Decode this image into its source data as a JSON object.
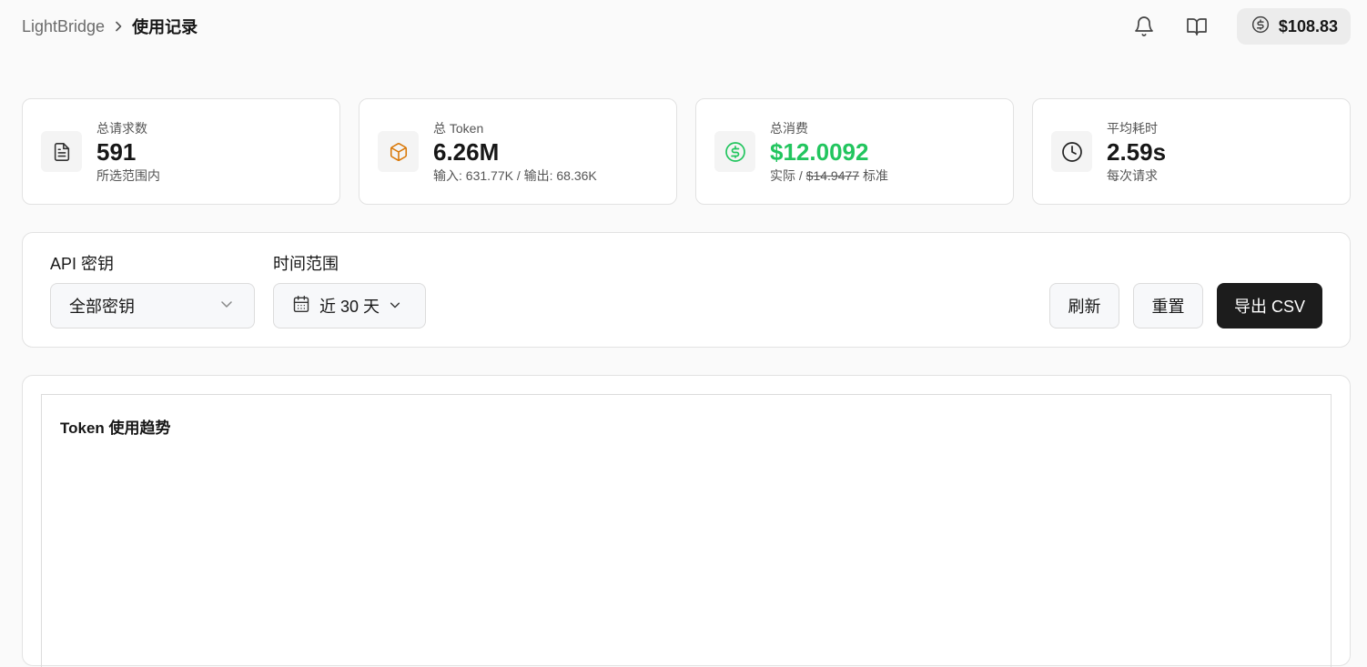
{
  "header": {
    "app_name": "LightBridge",
    "current_page": "使用记录",
    "balance": "$108.83",
    "icons": [
      "bell-icon",
      "book-open-icon",
      "dollar-circle-icon"
    ]
  },
  "stats": [
    {
      "label": "总请求数",
      "value": "591",
      "sub": "所选范围内",
      "icon": "file-text-icon"
    },
    {
      "label": "总 Token",
      "value": "6.26M",
      "sub": "输入: 631.77K / 输出: 68.36K",
      "icon": "box-icon",
      "icon_color": "#d97706"
    },
    {
      "label": "总消费",
      "value": "$12.0092",
      "sub_prefix": "实际 / ",
      "sub_strike": "$14.9477",
      "sub_suffix": " 标准",
      "icon": "dollar-circle-icon",
      "value_color": "#22c55e"
    },
    {
      "label": "平均耗时",
      "value": "2.59s",
      "sub": "每次请求",
      "icon": "clock-icon"
    }
  ],
  "filters": {
    "api_key_label": "API 密钥",
    "api_key_value": "全部密钥",
    "time_label": "时间范围",
    "time_value": "近 30 天",
    "refresh_label": "刷新",
    "reset_label": "重置",
    "export_label": "导出 CSV"
  },
  "chart": {
    "title": "Token 使用趋势"
  }
}
